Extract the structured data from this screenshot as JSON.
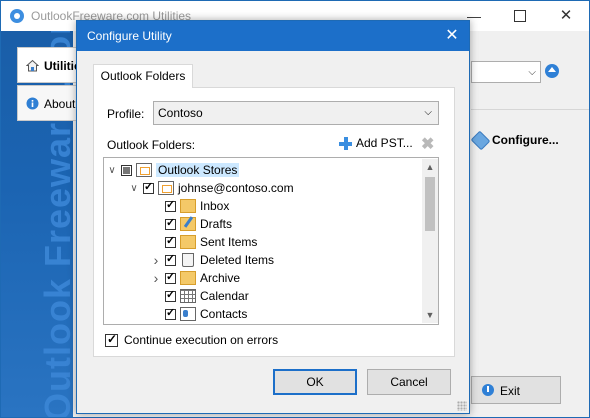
{
  "main_window": {
    "title": "OutlookFreeware.com Utilities",
    "brand_text": "Outlook Freeware .com",
    "tabs": [
      {
        "label": "Utilities"
      },
      {
        "label": "About"
      }
    ],
    "configure_label": "Configure...",
    "exit_label": "Exit"
  },
  "dialog": {
    "title": "Configure Utility",
    "tab_label": "Outlook Folders",
    "profile_label": "Profile:",
    "profile_value": "Contoso",
    "folders_label": "Outlook Folders:",
    "add_pst_label": "Add PST...",
    "tree": [
      {
        "label": "Outlook Stores",
        "level": 0,
        "checked": "partial",
        "expander": "open",
        "icon": "store-icon",
        "selected": true
      },
      {
        "label": "johnse@contoso.com",
        "level": 1,
        "checked": "checked",
        "expander": "open",
        "icon": "store-icon"
      },
      {
        "label": "Inbox",
        "level": 2,
        "checked": "checked",
        "icon": "inbox-folder-icon"
      },
      {
        "label": "Drafts",
        "level": 2,
        "checked": "checked",
        "icon": "drafts-folder-icon"
      },
      {
        "label": "Sent Items",
        "level": 2,
        "checked": "checked",
        "icon": "sent-folder-icon"
      },
      {
        "label": "Deleted Items",
        "level": 2,
        "checked": "checked",
        "expander": "closed",
        "icon": "deleted-folder-icon"
      },
      {
        "label": "Archive",
        "level": 2,
        "checked": "checked",
        "expander": "closed",
        "icon": "archive-folder-icon"
      },
      {
        "label": "Calendar",
        "level": 2,
        "checked": "checked",
        "icon": "calendar-icon"
      },
      {
        "label": "Contacts",
        "level": 2,
        "checked": "checked",
        "icon": "contacts-icon"
      }
    ],
    "continue_label": "Continue execution on errors",
    "continue_checked": true,
    "ok_label": "OK",
    "cancel_label": "Cancel"
  }
}
